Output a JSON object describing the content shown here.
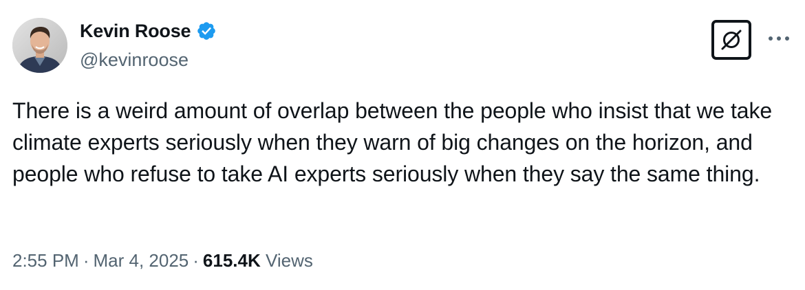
{
  "author": {
    "display_name": "Kevin Roose",
    "handle": "@kevinroose",
    "verified": true,
    "verified_icon": "verified-badge-icon",
    "avatar_icon": "avatar-photo"
  },
  "actions": {
    "grok_icon": "grok-icon",
    "more_icon": "more-dots-icon"
  },
  "tweet": {
    "text": "There is a weird amount of overlap between the people who insist that we take climate experts seriously when they warn of big changes on the horizon, and people who refuse to take AI experts seriously when they say the same thing."
  },
  "meta": {
    "time": "2:55 PM",
    "separator": "·",
    "date": "Mar 4, 2025",
    "views_count": "615.4K",
    "views_label": "Views"
  },
  "colors": {
    "text": "#0f1419",
    "secondary": "#536471",
    "verified_blue": "#1d9bf0"
  }
}
